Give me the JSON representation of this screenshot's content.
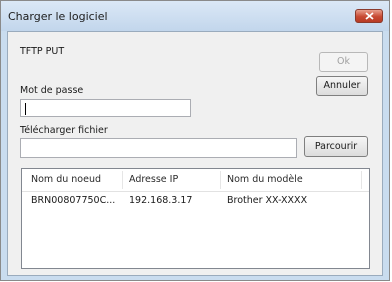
{
  "window": {
    "title": "Charger le logiciel"
  },
  "dialog": {
    "protocol_label": "TFTP PUT",
    "ok_label": "Ok",
    "cancel_label": "Annuler",
    "password_label": "Mot de passe",
    "password_value": "",
    "upload_file_label": "Télécharger fichier",
    "upload_file_value": "",
    "browse_label": "Parcourir"
  },
  "device_list": {
    "columns": [
      "Nom du noeud",
      "Adresse IP",
      "Nom du modèle"
    ],
    "rows": [
      {
        "node_name": "BRN00807750C...",
        "ip_address": "192.168.3.17",
        "model_name": "Brother XX-XXXX"
      }
    ]
  }
}
